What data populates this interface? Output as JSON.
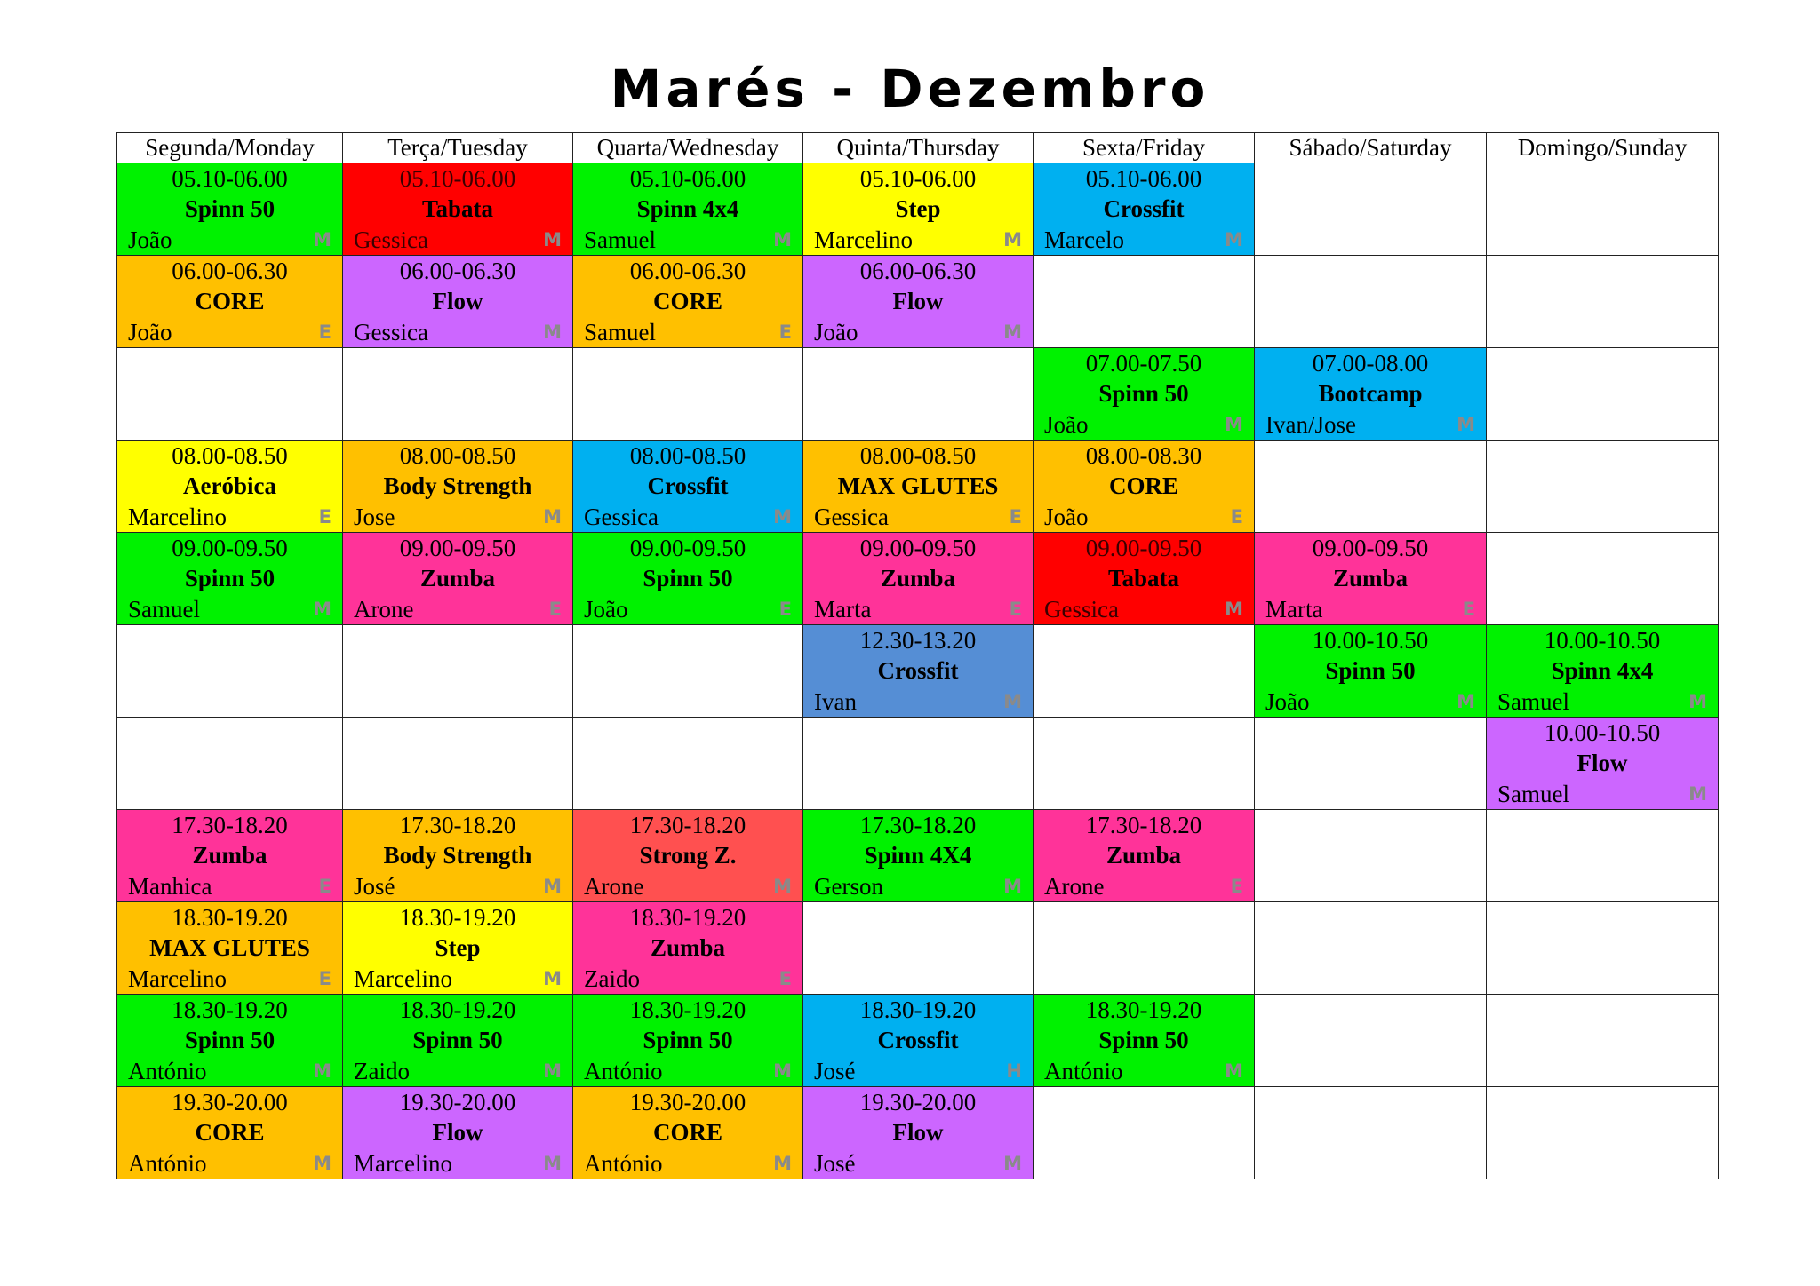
{
  "title": "Marés - Dezembro",
  "days": [
    "Segunda/Monday",
    "Terça/Tuesday",
    "Quarta/Wednesday",
    "Quinta/Thursday",
    "Sexta/Friday",
    "Sábado/Saturday",
    "Domingo/Sunday"
  ],
  "colors": {
    "green": "#00f200",
    "red": "#ff0000",
    "yellow": "#ffff00",
    "cyan": "#00b0f0",
    "orange": "#ffc000",
    "purple": "#cc66ff",
    "pink": "#ff3399",
    "steel": "#558ed5",
    "salmon": "#ff5050"
  },
  "rows": [
    [
      {
        "time": "05.10-06.00",
        "class": "Spinn 50",
        "instructor": "João",
        "level": "M",
        "color": "green"
      },
      {
        "time": "05.10-06.00",
        "class": "Tabata",
        "instructor": "Gessica",
        "level": "M",
        "color": "red"
      },
      {
        "time": "05.10-06.00",
        "class": "Spinn 4x4",
        "instructor": "Samuel",
        "level": "M",
        "color": "green"
      },
      {
        "time": "05.10-06.00",
        "class": "Step",
        "instructor": "Marcelino",
        "level": "M",
        "color": "yellow"
      },
      {
        "time": "05.10-06.00",
        "class": "Crossfit",
        "instructor": "Marcelo",
        "level": "M",
        "color": "cyan"
      },
      null,
      null
    ],
    [
      {
        "time": "06.00-06.30",
        "class": "CORE",
        "instructor": "João",
        "level": "E",
        "color": "orange"
      },
      {
        "time": "06.00-06.30",
        "class": "Flow",
        "instructor": "Gessica",
        "level": "M",
        "color": "purple"
      },
      {
        "time": "06.00-06.30",
        "class": "CORE",
        "instructor": "Samuel",
        "level": "E",
        "color": "orange"
      },
      {
        "time": "06.00-06.30",
        "class": "Flow",
        "instructor": "João",
        "level": "M",
        "color": "purple"
      },
      null,
      null,
      null
    ],
    [
      null,
      null,
      null,
      null,
      {
        "time": "07.00-07.50",
        "class": "Spinn 50",
        "instructor": "João",
        "level": "M",
        "color": "green"
      },
      {
        "time": "07.00-08.00",
        "class": "Bootcamp",
        "instructor": "Ivan/Jose",
        "level": "M",
        "color": "cyan"
      },
      null
    ],
    [
      {
        "time": "08.00-08.50",
        "class": "Aeróbica",
        "instructor": "Marcelino",
        "level": "E",
        "color": "yellow"
      },
      {
        "time": "08.00-08.50",
        "class": "Body Strength",
        "instructor": "Jose",
        "level": "M",
        "color": "orange"
      },
      {
        "time": "08.00-08.50",
        "class": "Crossfit",
        "instructor": "Gessica",
        "level": "M",
        "color": "cyan"
      },
      {
        "time": "08.00-08.50",
        "class": "MAX GLUTES",
        "instructor": "Gessica",
        "level": "E",
        "color": "orange"
      },
      {
        "time": "08.00-08.30",
        "class": "CORE",
        "instructor": "João",
        "level": "E",
        "color": "orange"
      },
      null,
      null
    ],
    [
      {
        "time": "09.00-09.50",
        "class": "Spinn 50",
        "instructor": "Samuel",
        "level": "M",
        "color": "green"
      },
      {
        "time": "09.00-09.50",
        "class": "Zumba",
        "instructor": "Arone",
        "level": "E",
        "color": "pink"
      },
      {
        "time": "09.00-09.50",
        "class": "Spinn 50",
        "instructor": "João",
        "level": "E",
        "color": "green"
      },
      {
        "time": "09.00-09.50",
        "class": "Zumba",
        "instructor": "Marta",
        "level": "E",
        "color": "pink"
      },
      {
        "time": "09.00-09.50",
        "class": "Tabata",
        "instructor": "Gessica",
        "level": "M",
        "color": "red"
      },
      {
        "time": "09.00-09.50",
        "class": "Zumba",
        "instructor": "Marta",
        "level": "E",
        "color": "pink"
      },
      null
    ],
    [
      null,
      null,
      null,
      {
        "time": "12.30-13.20",
        "class": "Crossfit",
        "instructor": "Ivan",
        "level": "M",
        "color": "steel"
      },
      null,
      {
        "time": "10.00-10.50",
        "class": "Spinn 50",
        "instructor": "João",
        "level": "M",
        "color": "green"
      },
      {
        "time": "10.00-10.50",
        "class": "Spinn 4x4",
        "instructor": "Samuel",
        "level": "M",
        "color": "green"
      }
    ],
    [
      null,
      null,
      null,
      null,
      null,
      null,
      {
        "time": "10.00-10.50",
        "class": "Flow",
        "instructor": "Samuel",
        "level": "M",
        "color": "purple"
      }
    ],
    [
      {
        "time": "17.30-18.20",
        "class": "Zumba",
        "instructor": "Manhica",
        "level": "E",
        "color": "pink"
      },
      {
        "time": "17.30-18.20",
        "class": "Body Strength",
        "instructor": "José",
        "level": "M",
        "color": "orange"
      },
      {
        "time": "17.30-18.20",
        "class": "Strong Z.",
        "instructor": "Arone",
        "level": "M",
        "color": "salmon"
      },
      {
        "time": "17.30-18.20",
        "class": "Spinn 4X4",
        "instructor": "Gerson",
        "level": "M",
        "color": "green"
      },
      {
        "time": "17.30-18.20",
        "class": "Zumba",
        "instructor": "Arone",
        "level": "E",
        "color": "pink"
      },
      null,
      null
    ],
    [
      {
        "time": "18.30-19.20",
        "class": "MAX GLUTES",
        "instructor": "Marcelino",
        "level": "E",
        "color": "orange"
      },
      {
        "time": "18.30-19.20",
        "class": "Step",
        "instructor": "Marcelino",
        "level": "M",
        "color": "yellow"
      },
      {
        "time": "18.30-19.20",
        "class": "Zumba",
        "instructor": "Zaido",
        "level": "E",
        "color": "pink"
      },
      null,
      null,
      null,
      null
    ],
    [
      {
        "time": "18.30-19.20",
        "class": "Spinn 50",
        "instructor": "António",
        "level": "M",
        "color": "green"
      },
      {
        "time": "18.30-19.20",
        "class": "Spinn 50",
        "instructor": "Zaido",
        "level": "M",
        "color": "green"
      },
      {
        "time": "18.30-19.20",
        "class": "Spinn 50",
        "instructor": "António",
        "level": "M",
        "color": "green"
      },
      {
        "time": "18.30-19.20",
        "class": "Crossfit",
        "instructor": "José",
        "level": "H",
        "color": "cyan"
      },
      {
        "time": "18.30-19.20",
        "class": "Spinn 50",
        "instructor": "António",
        "level": "M",
        "color": "green"
      },
      null,
      null
    ],
    [
      {
        "time": "19.30-20.00",
        "class": "CORE",
        "instructor": "António",
        "level": "M",
        "color": "orange"
      },
      {
        "time": "19.30-20.00",
        "class": "Flow",
        "instructor": "Marcelino",
        "level": "M",
        "color": "purple"
      },
      {
        "time": "19.30-20.00",
        "class": "CORE",
        "instructor": "António",
        "level": "M",
        "color": "orange"
      },
      {
        "time": "19.30-20.00",
        "class": "Flow",
        "instructor": "José",
        "level": "M",
        "color": "purple"
      },
      null,
      null,
      null
    ]
  ]
}
